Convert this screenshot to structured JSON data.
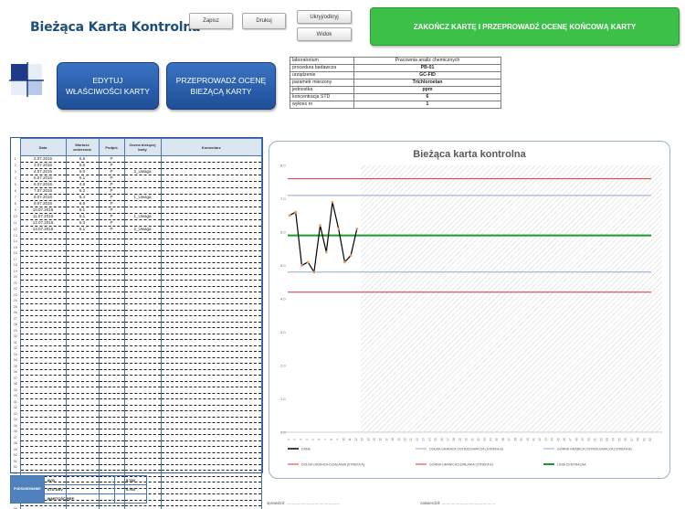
{
  "header": {
    "title": "Bieżąca Karta Kontrolna",
    "save_label": "Zapisz",
    "print_label": "Drukuj",
    "toggle_label": "Ukryj/odkryj",
    "view_label": "Widok",
    "finish_label": "ZAKOŃCZ KARTĘ I PRZEPROWADŹ OCENĘ KOŃCOWĄ KARTY",
    "edit_line1": "EDYTUJ",
    "edit_line2": "WŁAŚCIWOŚCI KARTY",
    "assess_line1": "PRZEPROWADŹ OCENĘ",
    "assess_line2": "BIEŻĄCĄ KARTY"
  },
  "info": [
    {
      "label": "laboratorium",
      "value": "Pracownia analiz chemicznych"
    },
    {
      "label": "procedura badawcza",
      "value": "PB-01"
    },
    {
      "label": "urządzenie",
      "value": "GC-FID"
    },
    {
      "label": "parametr mierzony",
      "value": "Trichloroetan"
    },
    {
      "label": "jednostka",
      "value": "ppm"
    },
    {
      "label": "koncentracja STD",
      "value": "6"
    },
    {
      "label": "wykres nr",
      "value": "1"
    }
  ],
  "table": {
    "headers": [
      "Data",
      "Wartość zmierzona",
      "Podpis",
      "Ocena bieżącej karty",
      "Komentarz"
    ],
    "rows": [
      {
        "nr": "1",
        "date": "2.07.2016",
        "value": "6.5",
        "sign": "P",
        "eval": ""
      },
      {
        "nr": "2",
        "date": "3.07.2016",
        "value": "6.6",
        "sign": "P",
        "eval": ""
      },
      {
        "nr": "3",
        "date": "4.07.2016",
        "value": "5.0",
        "sign": "P",
        "eval": "2_Uwaga"
      },
      {
        "nr": "4",
        "date": "5.07.2016",
        "value": "5.1",
        "sign": "P",
        "eval": ""
      },
      {
        "nr": "5",
        "date": "6.07.2016",
        "value": "4.8",
        "sign": "P",
        "eval": ""
      },
      {
        "nr": "6",
        "date": "7.07.2016",
        "value": "6.2",
        "sign": "P",
        "eval": ""
      },
      {
        "nr": "7",
        "date": "8.07.2016",
        "value": "5.4",
        "sign": "P",
        "eval": "1_Uwaga"
      },
      {
        "nr": "8",
        "date": "9.07.2016",
        "value": "6.9",
        "sign": "P",
        "eval": ""
      },
      {
        "nr": "9",
        "date": "10.07.2016",
        "value": "6.1",
        "sign": "P",
        "eval": ""
      },
      {
        "nr": "10",
        "date": "11.07.2016",
        "value": "5.1",
        "sign": "P",
        "eval": "1_Uwaga"
      },
      {
        "nr": "11",
        "date": "12.07.2016",
        "value": "5.3",
        "sign": "P",
        "eval": ""
      },
      {
        "nr": "12",
        "date": "13.07.2016",
        "value": "6.1",
        "sign": "P",
        "eval": "2_Uwaga"
      }
    ],
    "empty_row_count": 48
  },
  "stats": {
    "side_label": "PODSUMOWANIE",
    "avg_label": "AVG",
    "avg_value": "5.780",
    "std_label": "STD DEV",
    "std_value": "0.760",
    "extra_label": "WARTOŚĆ REF."
  },
  "footer": {
    "checked": "sprawdził: ...............................................",
    "approved": "zatwierdził: ..............................................."
  },
  "chart_data": {
    "type": "line",
    "title": "Bieżąca karta kontrolna",
    "x": [
      1,
      2,
      3,
      4,
      5,
      6,
      7,
      8,
      9,
      10,
      11,
      12
    ],
    "x_ticks": [
      1,
      2,
      3,
      4,
      5,
      6,
      7,
      8,
      9,
      10,
      11,
      12,
      13,
      14,
      15,
      16,
      17,
      18,
      19,
      20,
      21,
      22,
      23,
      24,
      25,
      26,
      27,
      28,
      29,
      30,
      31,
      32,
      33,
      34,
      35,
      36,
      37,
      38,
      39,
      40,
      41,
      42,
      43,
      44,
      45,
      46,
      47,
      48,
      49,
      50,
      51,
      52,
      53,
      54,
      55,
      56,
      57,
      58,
      59,
      60
    ],
    "xlim": [
      1,
      60
    ],
    "ylim": [
      0,
      8
    ],
    "y_ticks": [
      0,
      1,
      2,
      3,
      4,
      5,
      6,
      7,
      8
    ],
    "y_tick_labels": [
      "0.0",
      "1.0",
      "2.0",
      "3.0",
      "4.0",
      "5.0",
      "6.0",
      "7.0",
      "8.0"
    ],
    "series": [
      {
        "name": "DANE",
        "values": [
          6.5,
          6.6,
          5.0,
          5.1,
          4.8,
          6.2,
          5.4,
          6.9,
          6.1,
          5.1,
          5.3,
          6.1
        ],
        "color": "#000000"
      }
    ],
    "limits": [
      {
        "name": "DOLNA GRANICA OSTRZEGAWCZA (STREFA B)",
        "value": 4.8,
        "color": "#8fa8d8"
      },
      {
        "name": "GÓRNA GRANICA OSTRZEGAWCZA (STREFA B)",
        "value": 7.1,
        "color": "#8fa8d8"
      },
      {
        "name": "DOLNA GRANICA DZIAŁANIA (STREFA A)",
        "value": 4.2,
        "color": "#e03030"
      },
      {
        "name": "GÓRNA GRANICA DZIAŁANIA (STREFA A)",
        "value": 7.6,
        "color": "#e03030"
      },
      {
        "name": "LINIA CENTRALNA",
        "value": 5.9,
        "color": "#1a9a2a"
      }
    ],
    "grid": false,
    "legend": "bottom"
  }
}
